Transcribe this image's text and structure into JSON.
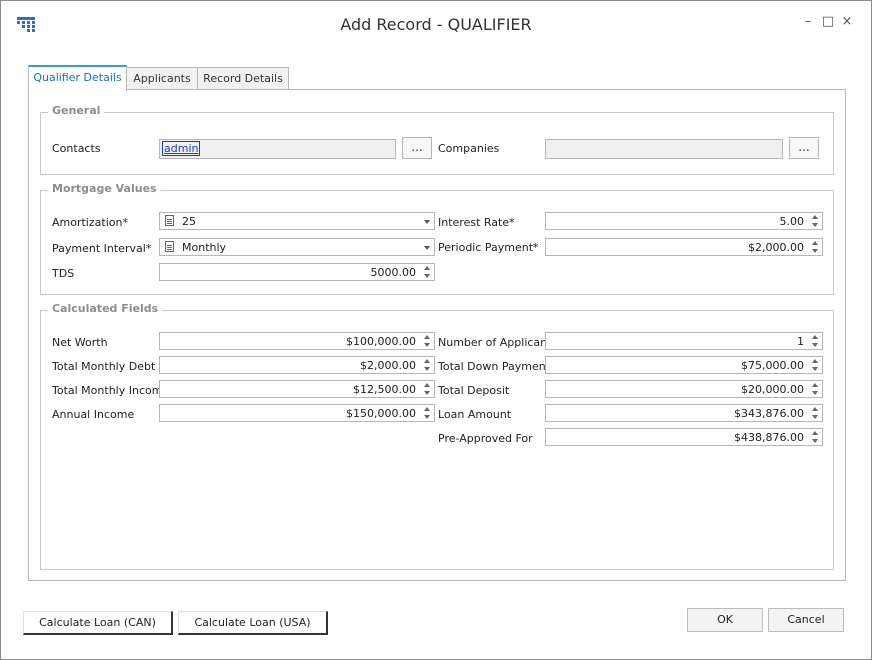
{
  "window": {
    "title": "Add Record - QUALIFIER",
    "controls": {
      "minimize": "–",
      "maximize": "□",
      "close": "×"
    },
    "app_icon": "grid-app-icon"
  },
  "tabs": [
    {
      "label": "Qualifier Details",
      "active": true
    },
    {
      "label": "Applicants",
      "active": false
    },
    {
      "label": "Record Details",
      "active": false
    }
  ],
  "general": {
    "title": "General",
    "contacts_label": "Contacts",
    "contacts_value": "admin",
    "companies_label": "Companies",
    "companies_value": "",
    "browse_label": "..."
  },
  "mortgage": {
    "title": "Mortgage Values",
    "amortization_label": "Amortization*",
    "amortization_value": "25",
    "payment_interval_label": "Payment Interval*",
    "payment_interval_value": "Monthly",
    "tds_label": "TDS",
    "tds_value": "5000.00",
    "interest_rate_label": "Interest Rate*",
    "interest_rate_value": "5.00",
    "periodic_payment_label": "Periodic Payment*",
    "periodic_payment_value": "$2,000.00"
  },
  "calculated": {
    "title": "Calculated Fields",
    "net_worth_label": "Net Worth",
    "net_worth_value": "$100,000.00",
    "total_monthly_debt_label": "Total Monthly Debt",
    "total_monthly_debt_value": "$2,000.00",
    "total_monthly_income_label": "Total Monthly Income",
    "total_monthly_income_value": "$12,500.00",
    "annual_income_label": "Annual Income",
    "annual_income_value": "$150,000.00",
    "num_applicants_label": "Number of Applicants",
    "num_applicants_value": "1",
    "total_down_payment_label": "Total Down Payment",
    "total_down_payment_value": "$75,000.00",
    "total_deposit_label": "Total Deposit",
    "total_deposit_value": "$20,000.00",
    "loan_amount_label": "Loan Amount",
    "loan_amount_value": "$343,876.00",
    "pre_approved_label": "Pre-Approved For",
    "pre_approved_value": "$438,876.00"
  },
  "buttons": {
    "calc_can": "Calculate Loan (CAN)",
    "calc_usa": "Calculate Loan (USA)",
    "ok": "OK",
    "cancel": "Cancel"
  },
  "colors": {
    "accent": "#3a9bd8",
    "link": "#1a3fc4",
    "group_title": "#8d8d8d"
  }
}
